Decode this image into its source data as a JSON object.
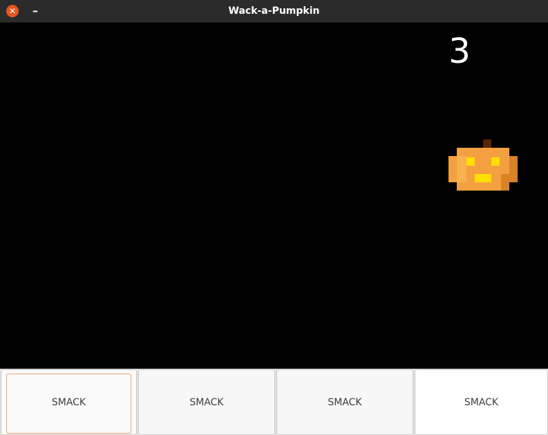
{
  "window": {
    "title": "Wack-a-Pumpkin",
    "close_icon_glyph": "✕",
    "minimize_icon_glyph": "–"
  },
  "game": {
    "score": "3",
    "pumpkin_icon": "pumpkin-icon"
  },
  "buttons": [
    {
      "label": "SMACK"
    },
    {
      "label": "SMACK"
    },
    {
      "label": "SMACK"
    },
    {
      "label": "SMACK"
    }
  ],
  "colors": {
    "titlebar": "#2b2b2b",
    "close_button": "#e95420",
    "canvas_background": "#000000",
    "pumpkin_orange": "#f5a040",
    "pumpkin_dark": "#d8822a",
    "pumpkin_eyes": "#ffe000",
    "stem": "#5a2600",
    "focus_ring": "#f0a070"
  }
}
